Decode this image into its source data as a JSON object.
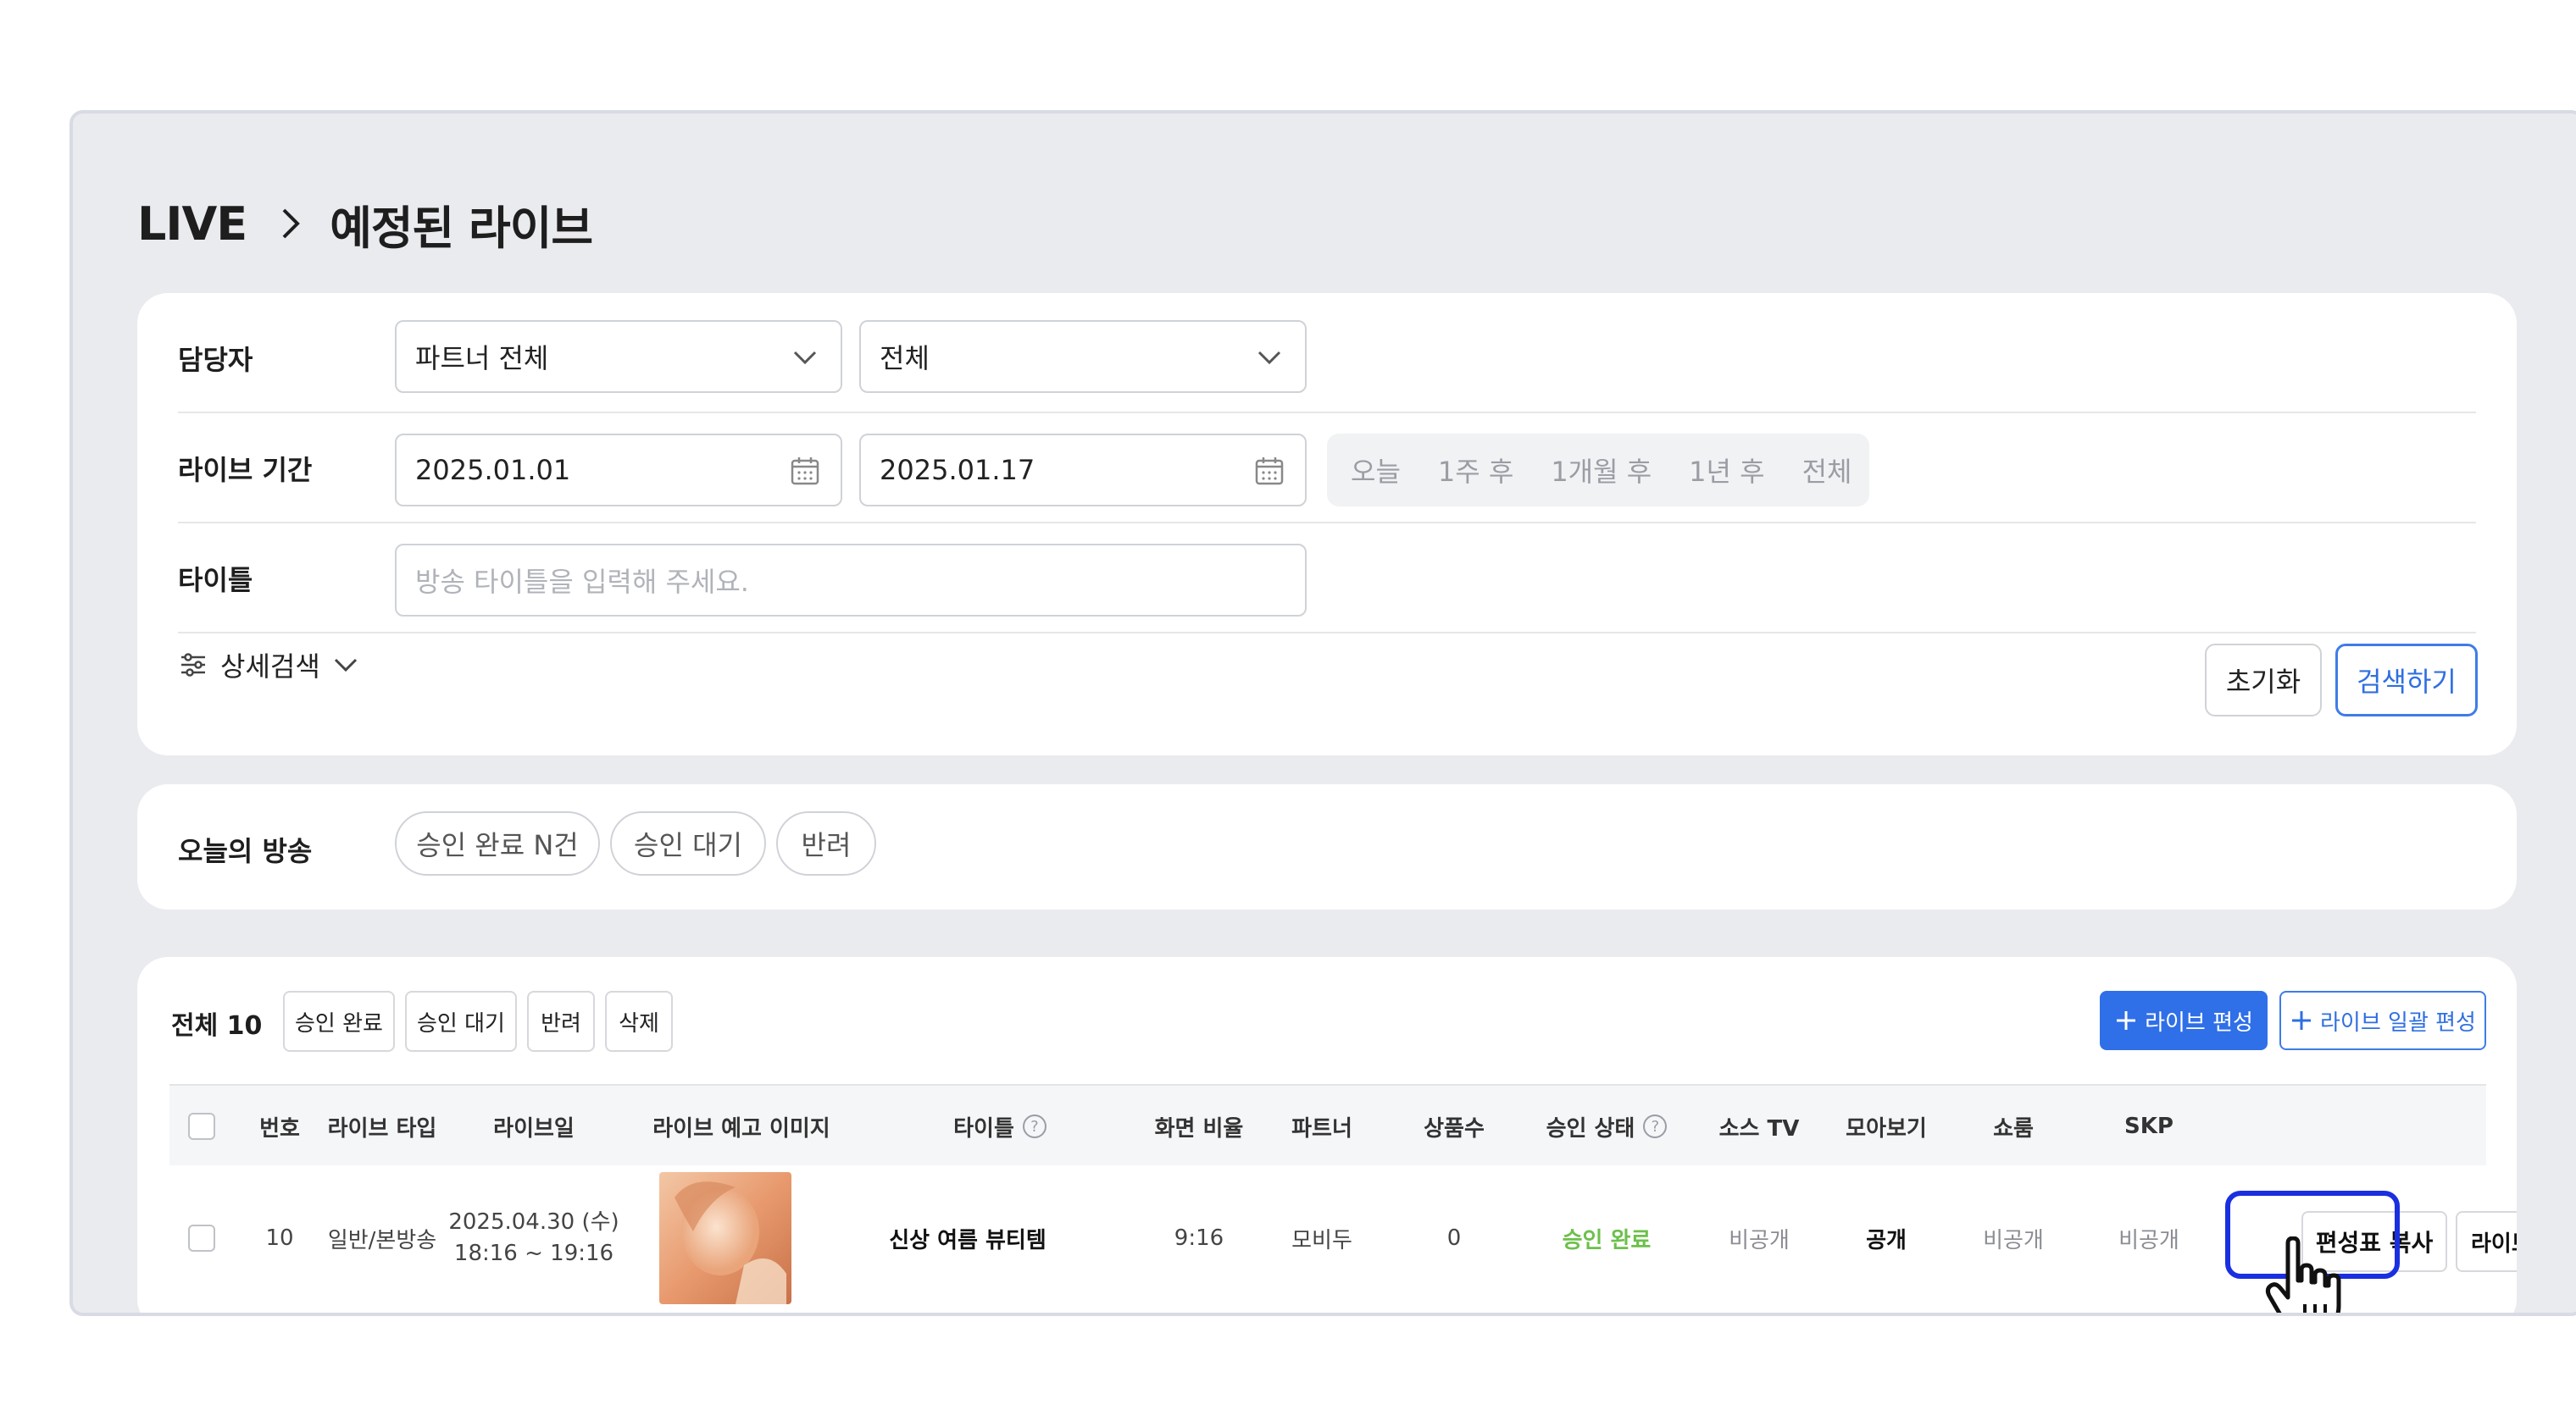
{
  "breadcrumb": {
    "root": "LIVE",
    "current": "예정된 라이브"
  },
  "filters": {
    "manager": {
      "label": "담당자",
      "partner_select": "파트너 전체",
      "sub_select": "전체"
    },
    "period": {
      "label": "라이브 기간",
      "start_date": "2025.01.01",
      "end_date": "2025.01.17",
      "quick_ranges": [
        "오늘",
        "1주 후",
        "1개월 후",
        "1년 후",
        "전체"
      ]
    },
    "title": {
      "label": "타이틀",
      "placeholder": "방송 타이틀을 입력해 주세요."
    },
    "advanced_label": "상세검색",
    "reset_label": "초기화",
    "search_label": "검색하기"
  },
  "today": {
    "label": "오늘의 방송",
    "pills": [
      "승인 완료 N건",
      "승인 대기",
      "반려"
    ]
  },
  "table": {
    "total_label": "전체 10",
    "actions": [
      "승인 완료",
      "승인 대기",
      "반려",
      "삭제"
    ],
    "live_edit_label": "라이브 편성",
    "bulk_edit_label": "라이브 일괄 편성",
    "headers": [
      "번호",
      "라이브 타입",
      "라이브일",
      "라이브 예고 이미지",
      "타이틀",
      "화면 비율",
      "파트너",
      "상품수",
      "승인 상태",
      "소스 TV",
      "모아보기",
      "쇼룸",
      "SKP"
    ],
    "rows": [
      {
        "number": "10",
        "type": "일반/본방송",
        "date": "2025.04.30 (수)",
        "time": "18:16 ~ 19:16",
        "title": "신상 여름 뷰티템",
        "ratio": "9:16",
        "partner": "모비두",
        "product_count": "0",
        "status": "승인 완료",
        "source_tv": "비공개",
        "collection": "공개",
        "showroom": "비공개",
        "skp": "비공개",
        "copy_label": "편성표 복사",
        "console_label": "라이브 콘솔"
      }
    ]
  },
  "colors": {
    "accent": "#2f6fe8",
    "status_approved": "#6cc04a",
    "highlight": "#1a2fe0"
  },
  "icons": [
    "chevron-right-icon",
    "chevron-down-icon",
    "calendar-icon",
    "sliders-icon",
    "plus-icon",
    "help-icon",
    "hand-pointer-icon"
  ]
}
